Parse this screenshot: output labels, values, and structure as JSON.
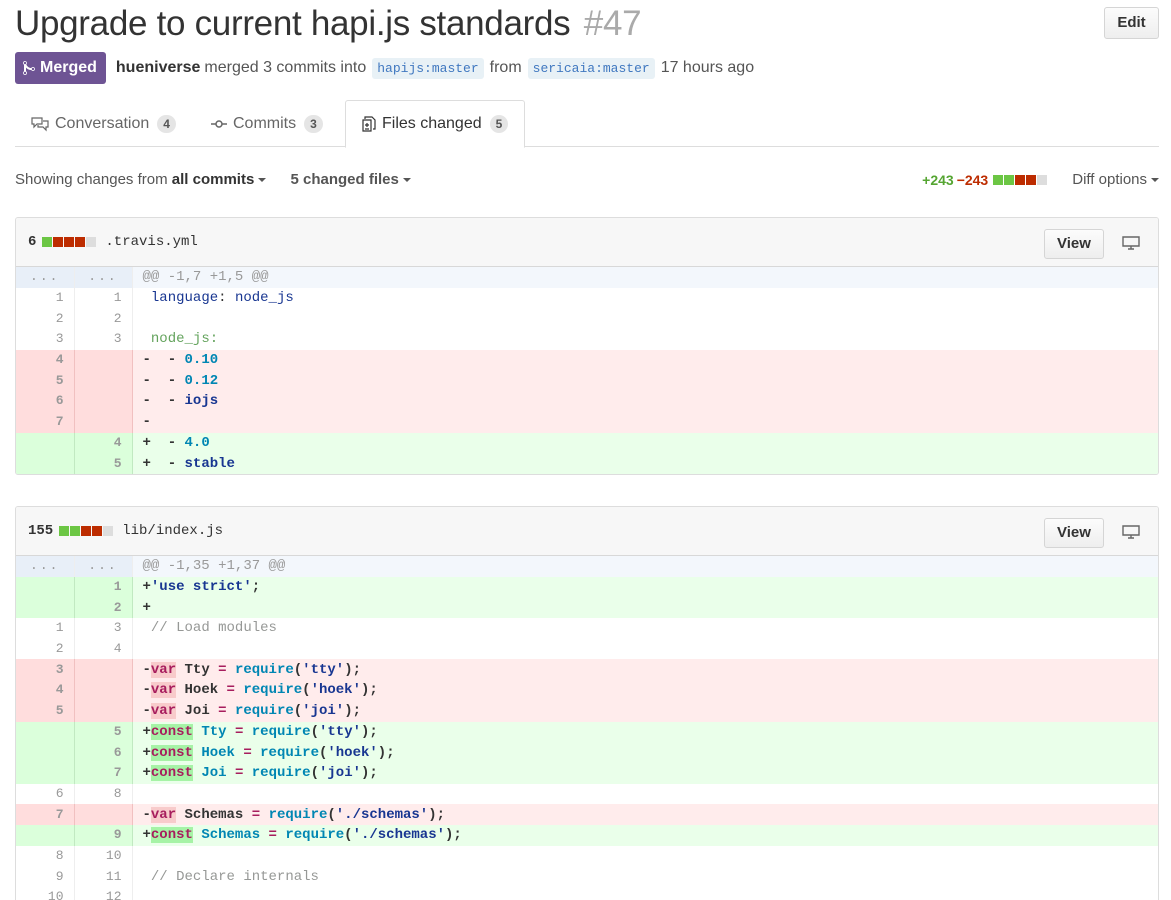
{
  "pr": {
    "title": "Upgrade to current hapi.js standards",
    "number": "#47",
    "edit_label": "Edit",
    "state": "Merged",
    "author": "hueniverse",
    "merge_text": "merged 3 commits into",
    "base_ref": "hapijs:master",
    "from_text": "from",
    "head_ref": "sericaia:master",
    "time": "17 hours ago"
  },
  "tabs": [
    {
      "label": "Conversation",
      "count": "4",
      "icon": "comment-discussion-icon"
    },
    {
      "label": "Commits",
      "count": "3",
      "icon": "git-commit-icon"
    },
    {
      "label": "Files changed",
      "count": "5",
      "icon": "diff-icon",
      "selected": true
    }
  ],
  "toolbar": {
    "showing_prefix": "Showing changes from",
    "all_commits": "all commits",
    "changed_files": "5 changed files",
    "additions": "+243",
    "deletions": "−243",
    "diff_options": "Diff options"
  },
  "colors": {
    "merged_purple": "#6e5494",
    "addition_green": "#6cc644",
    "deletion_red": "#bd2c00"
  },
  "files": [
    {
      "changes": "6",
      "path": ".travis.yml",
      "view_label": "View",
      "blocks": [
        "g",
        "r",
        "r",
        "r",
        "n"
      ]
    },
    {
      "changes": "155",
      "path": "lib/index.js",
      "view_label": "View",
      "blocks": [
        "g",
        "g",
        "r",
        "r",
        "n"
      ]
    }
  ]
}
